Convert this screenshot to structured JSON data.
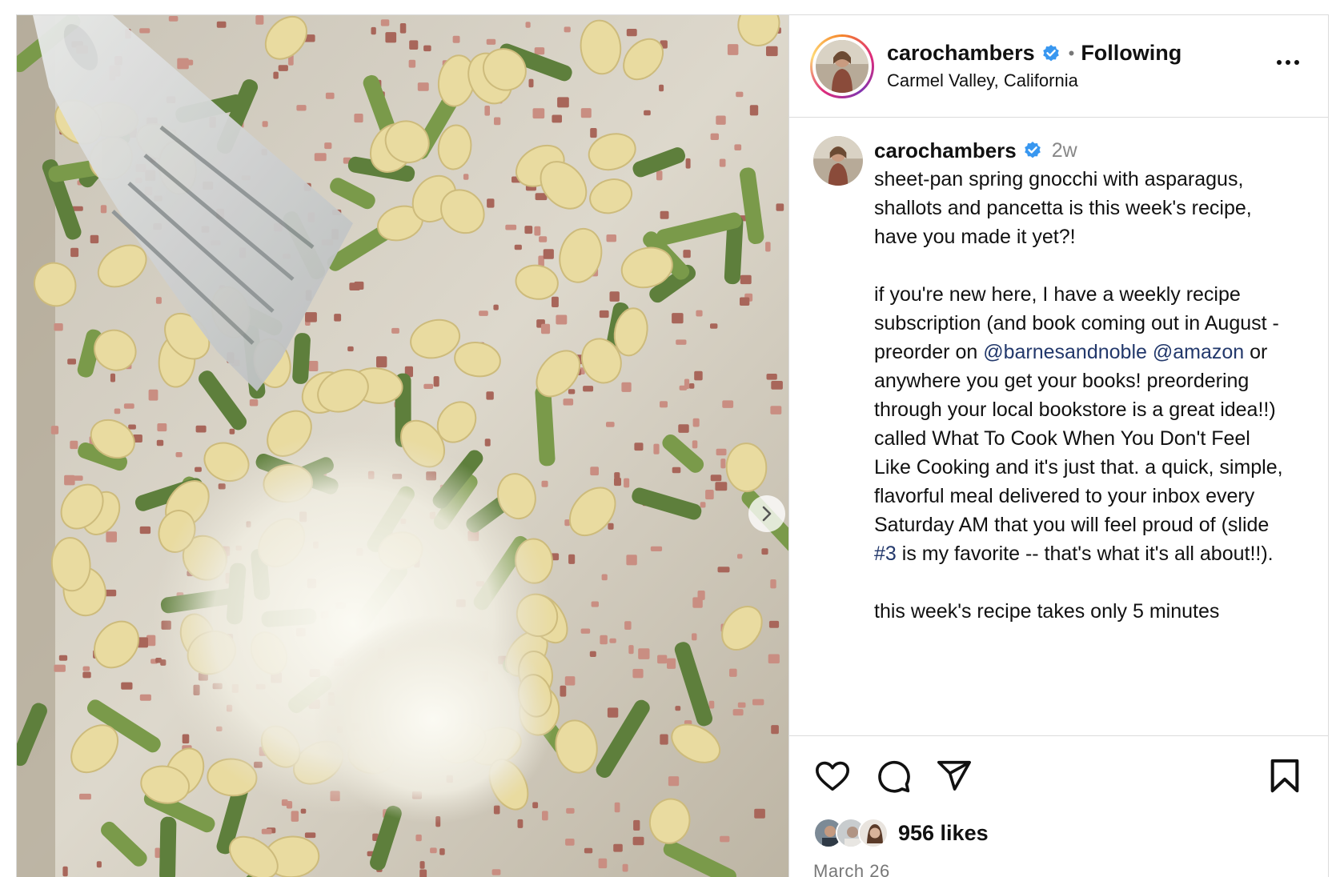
{
  "post": {
    "username": "carochambers",
    "follow_state": "Following",
    "separator": "•",
    "location": "Carmel Valley, California",
    "more_icon": "more-horizontal-icon",
    "verified_color": "#3897f0"
  },
  "caption": {
    "username": "carochambers",
    "time": "2w",
    "p1": "sheet-pan spring gnocchi with asparagus, shallots and pancetta is this week's recipe, have you made it yet?!",
    "p2_a": "if you're new here, I have a weekly recipe subscription (and book coming out in August - preorder on ",
    "mention1": "@barnesandnoble",
    "mention2": "@amazon",
    "p2_b": " or anywhere you get your books! preordering through your local bookstore is a great idea!!) called What To Cook When You Don't Feel Like Cooking and it's just that. a quick, simple, flavorful meal delivered to your inbox every Saturday AM that you will feel proud of (slide ",
    "hashtag": "#3",
    "p2_c": " is my favorite -- that's what it's all about!!).",
    "p3": "this week's recipe takes only 5 minutes"
  },
  "actions": {
    "like_icon": "heart-icon",
    "comment_icon": "comment-icon",
    "share_icon": "share-icon",
    "save_icon": "bookmark-icon",
    "likes": "956 likes",
    "date": "March 26"
  },
  "media": {
    "next_icon": "chevron-right-icon",
    "link_color": "#22386b"
  }
}
